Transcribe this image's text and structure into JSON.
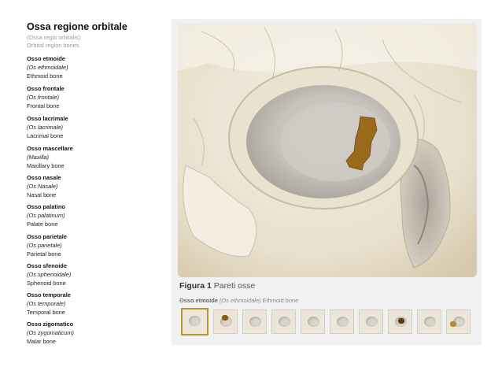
{
  "sidebar": {
    "title": "Ossa regione orbitale",
    "latin": "(Ossa regio orbitalis)",
    "english": "Orbital region bones",
    "items": [
      {
        "name": "Osso etmoide",
        "latin": "(Os ethmoidale)",
        "english": "Ethmoid bone"
      },
      {
        "name": "Osso frontale",
        "latin": "(Os frontale)",
        "english": "Frontal bone"
      },
      {
        "name": "Osso lacrimale",
        "latin": "(Os lacrimale)",
        "english": "Lacrimal bone"
      },
      {
        "name": "Osso mascellare",
        "latin": "(Maxilla)",
        "english": "Maxillary bone"
      },
      {
        "name": "Osso nasale",
        "latin": "(Os Nasale)",
        "english": "Nasal bone"
      },
      {
        "name": "Osso palatino",
        "latin": "(Os palatinum)",
        "english": "Palate bone"
      },
      {
        "name": "Osso parietale",
        "latin": "(Os parietale)",
        "english": "Parietal bone"
      },
      {
        "name": "Osso sfenoide",
        "latin": "(Os sphenoidale)",
        "english": "Sphenoid bone"
      },
      {
        "name": "Osso temporale",
        "latin": "(Os temporale)",
        "english": "Temporal bone"
      },
      {
        "name": "Osso zigomatico",
        "latin": "(Os zygomaticum)",
        "english": "Malar bone"
      }
    ]
  },
  "figure": {
    "number": "Figura 1",
    "title": "Pareti osse",
    "selected_name": "Osso etmoide",
    "selected_latin": "(Os ethmoidale)",
    "selected_english": "Ethmoid bone",
    "highlight_color": "#9a6a1c",
    "accent_color": "#b8962e",
    "thumbnail_count": 10,
    "selected_thumbnail": 1
  }
}
